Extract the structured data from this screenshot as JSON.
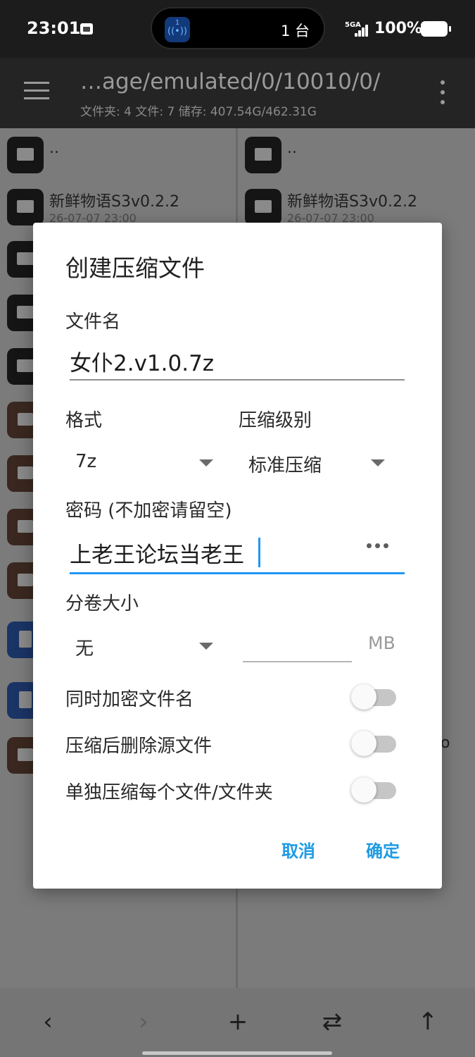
{
  "status_bar": {
    "time": "23:01",
    "island_count": "1 台",
    "island_badge_num": "1",
    "network": "5GA",
    "battery": "100%"
  },
  "app_bar": {
    "path": "…age/emulated/0/10010/0/",
    "stats": "文件夹: 4  文件: 7  储存: 407.54G/462.31G"
  },
  "left_pane": {
    "items": [
      {
        "name": "..",
        "date": "",
        "type": "folder"
      },
      {
        "name": "新鲜物语S3v0.2.2",
        "date": "26-07-07 23:00",
        "type": "folder"
      },
      {
        "name": "",
        "date": "",
        "type": "folder"
      },
      {
        "name": "",
        "date": "",
        "type": "folder"
      },
      {
        "name": "",
        "date": "",
        "type": "folder"
      },
      {
        "name": "",
        "date": "",
        "type": "archive"
      },
      {
        "name": "",
        "date": "",
        "type": "archive"
      },
      {
        "name": "",
        "date": "",
        "type": "archive"
      },
      {
        "name": "",
        "date": "",
        "type": "archive"
      },
      {
        "name": "",
        "date": "",
        "type": "doc"
      },
      {
        "name": "",
        "date": "",
        "type": "doc"
      },
      {
        "name": "",
        "date": "",
        "type": "archive"
      }
    ]
  },
  "right_pane": {
    "items": [
      {
        "name": "..",
        "date": "",
        "type": "folder"
      },
      {
        "name": "新鲜物语S3v0.2.2",
        "date": "26-07-07 23:00",
        "type": "folder"
      }
    ],
    "tail_text": "o"
  },
  "bottom_bar": {
    "back": "‹",
    "forward": "›",
    "add": "+",
    "swap": "⇄",
    "up": "↑"
  },
  "dialog": {
    "title": "创建压缩文件",
    "filename_label": "文件名",
    "filename_value": "女仆2.v1.0.7z",
    "format_label": "格式",
    "format_value": "7z",
    "level_label": "压缩级别",
    "level_value": "标准压缩",
    "password_label": "密码 (不加密请留空)",
    "password_value": "上老王论坛当老王",
    "split_label": "分卷大小",
    "split_value": "无",
    "split_size": "",
    "split_unit": "MB",
    "toggles": [
      {
        "label": "同时加密文件名",
        "on": false
      },
      {
        "label": "压缩后删除源文件",
        "on": false
      },
      {
        "label": "单独压缩每个文件/文件夹",
        "on": false
      }
    ],
    "cancel": "取消",
    "confirm": "确定"
  }
}
